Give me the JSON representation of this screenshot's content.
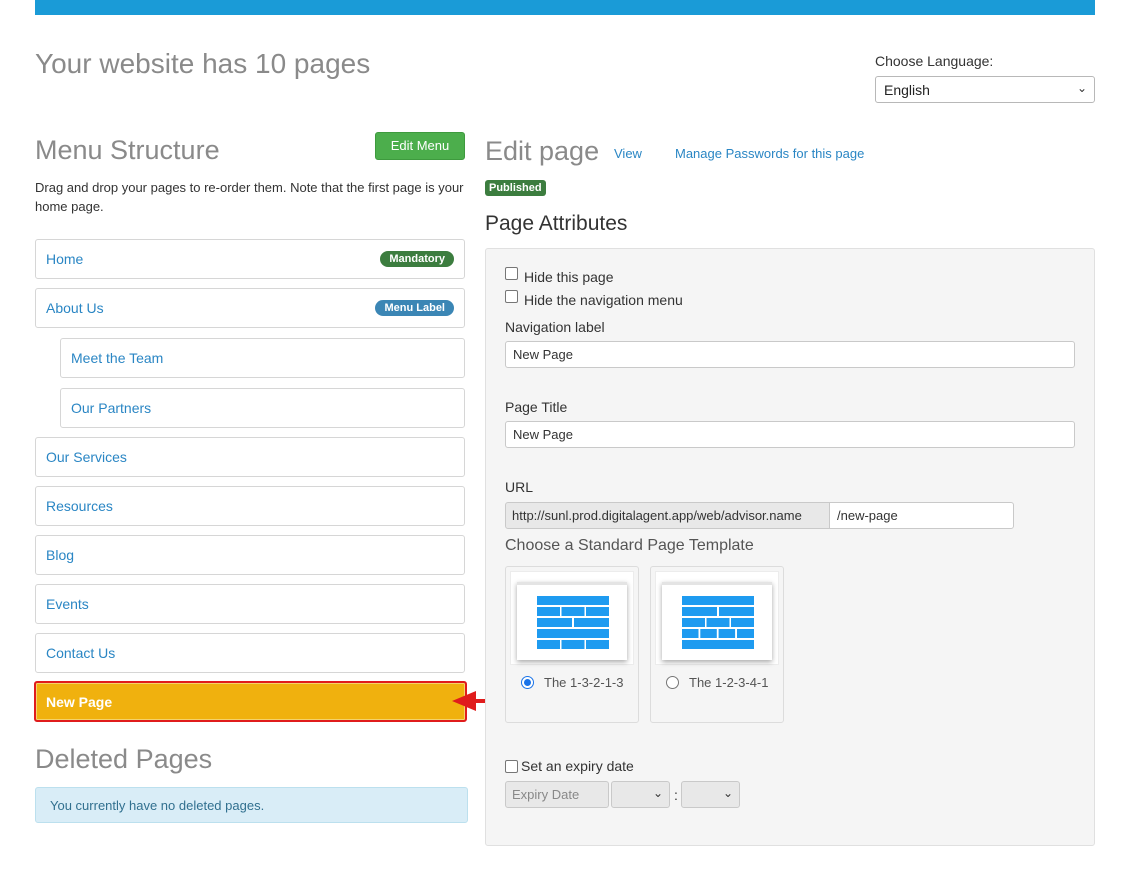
{
  "header": {
    "title": "Your website has 10 pages",
    "language_label": "Choose Language:",
    "language_value": "English"
  },
  "menu": {
    "heading": "Menu Structure",
    "edit_button": "Edit Menu",
    "description": "Drag and drop your pages to re-order them. Note that the first page is your home page.",
    "items": [
      {
        "label": "Home",
        "badge": "Mandatory"
      },
      {
        "label": "About Us",
        "badge": "Menu Label"
      },
      {
        "label": "Meet the Team"
      },
      {
        "label": "Our Partners"
      },
      {
        "label": "Our Services"
      },
      {
        "label": "Resources"
      },
      {
        "label": "Blog"
      },
      {
        "label": "Events"
      },
      {
        "label": "Contact Us"
      },
      {
        "label": "New Page"
      }
    ]
  },
  "deleted": {
    "heading": "Deleted Pages",
    "message": "You currently have no deleted pages."
  },
  "edit_page": {
    "heading": "Edit page",
    "view_link": "View",
    "passwords_link": "Manage Passwords for this page",
    "status": "Published",
    "attributes_heading": "Page Attributes",
    "hide_page_label": "Hide this page",
    "hide_nav_label": "Hide the navigation menu",
    "nav_label_caption": "Navigation label",
    "nav_label_value": "New Page",
    "page_title_caption": "Page Title",
    "page_title_value": "New Page",
    "url_caption": "URL",
    "url_prefix": "http://sunl.prod.digitalagent.app/web/advisor.name",
    "url_slug": "/new-page",
    "template_heading": "Choose a Standard Page Template",
    "templates": [
      {
        "name": "The 1-3-2-1-3",
        "selected": true
      },
      {
        "name": "The 1-2-3-4-1",
        "selected": false
      }
    ],
    "expiry_label": "Set an expiry date",
    "expiry_placeholder": "Expiry Date",
    "time_separator": ":"
  },
  "colors": {
    "accent_blue": "#1a9bd7",
    "button_green": "#4cae4c",
    "badge_green": "#3c7d3f",
    "badge_blue": "#3b86b5",
    "active_item": "#f0b10e",
    "highlight_red": "#e01c1c"
  }
}
